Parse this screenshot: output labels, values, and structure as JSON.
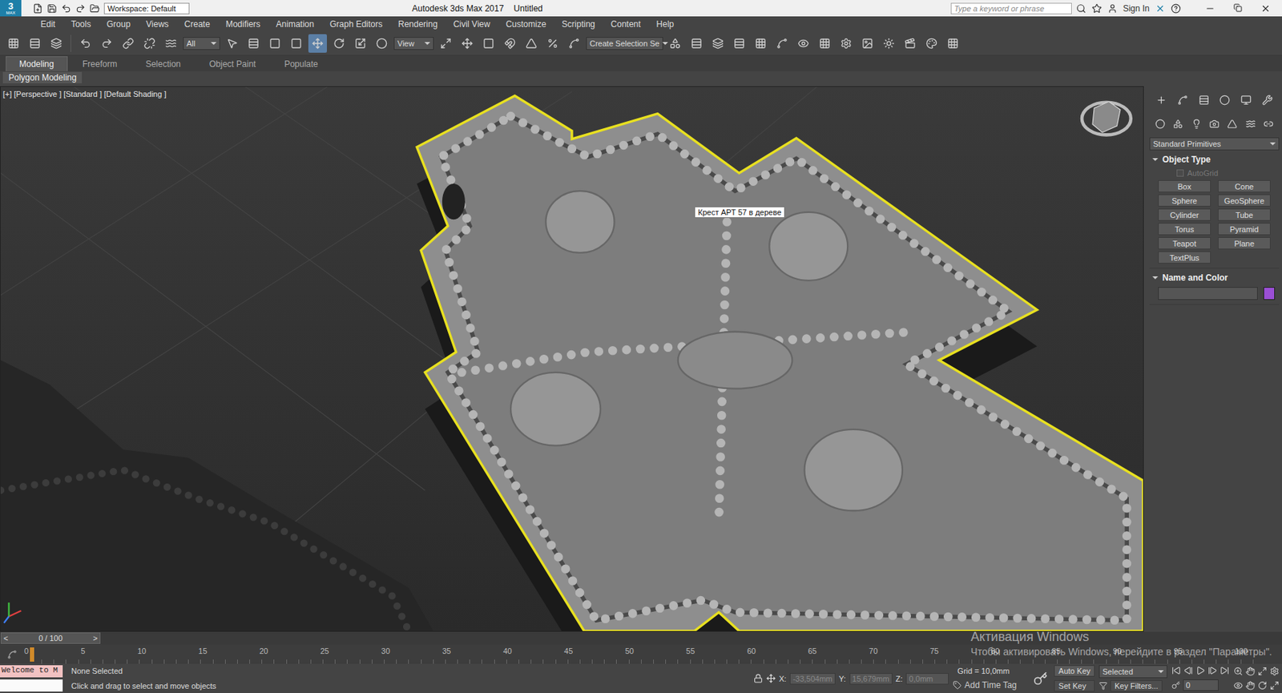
{
  "window": {
    "logo": "MAX",
    "logo_number": "3",
    "title": "Autodesk 3ds Max 2017",
    "document": "Untitled"
  },
  "workspace": "Workspace: Default",
  "search": {
    "placeholder": "Type a keyword or phrase"
  },
  "sign_in": "Sign In",
  "menu": [
    "Edit",
    "Tools",
    "Group",
    "Views",
    "Create",
    "Modifiers",
    "Animation",
    "Graph Editors",
    "Rendering",
    "Civil View",
    "Customize",
    "Scripting",
    "Content",
    "Help"
  ],
  "toolbar": {
    "selection_filter": "All",
    "reference_coord": "View",
    "named_selection": "Create Selection Se"
  },
  "ribbon": {
    "tabs": [
      {
        "label": "Modeling",
        "selected": true
      },
      {
        "label": "Freeform",
        "selected": false
      },
      {
        "label": "Selection",
        "selected": false
      },
      {
        "label": "Object Paint",
        "selected": false
      },
      {
        "label": "Populate",
        "selected": false
      }
    ],
    "panel": "Polygon Modeling"
  },
  "viewport": {
    "labels": [
      "[+]",
      "[Perspective ]",
      "[Standard ]",
      "[Default Shading ]"
    ],
    "tooltip": "Крест АРТ 57 в дереве",
    "model_selected": true
  },
  "command_panel": {
    "category": "Standard Primitives",
    "object_type": {
      "title": "Object Type",
      "autogrid": {
        "label": "AutoGrid",
        "checked": false,
        "disabled": true
      },
      "buttons": [
        "Box",
        "Cone",
        "Sphere",
        "GeoSphere",
        "Cylinder",
        "Tube",
        "Torus",
        "Pyramid",
        "Teapot",
        "Plane",
        "TextPlus"
      ]
    },
    "name_and_color": {
      "title": "Name and Color",
      "name": "",
      "color": "#9b4fd6"
    }
  },
  "time_slider": {
    "label": "0 / 100",
    "level": 0,
    "prev": "<",
    "next": ">"
  },
  "track_bar": {
    "ticks": [
      "0",
      "5",
      "10",
      "15",
      "20",
      "25",
      "30",
      "35",
      "40",
      "45",
      "50",
      "55",
      "60",
      "65",
      "70",
      "75",
      "80",
      "85",
      "90",
      "95",
      "100"
    ]
  },
  "status": {
    "listener": "Welcome to M",
    "selection": "None Selected",
    "prompt": "Click and drag to select and move objects",
    "x_label": "X:",
    "x": "-33,504mm",
    "y_label": "Y:",
    "y": "15,679mm",
    "z_label": "Z:",
    "z": "0,0mm",
    "grid": "Grid = 10,0mm",
    "add_time_tag": "Add Time Tag",
    "auto_key": "Auto Key",
    "key_mode": "Selected",
    "set_key": "Set Key",
    "key_filters": "Key Filters...",
    "frame": "0"
  },
  "watermark": {
    "title": "Активация Windows",
    "text": "Чтобы активировать Windows, перейдите в раздел \"Параметры\"."
  }
}
